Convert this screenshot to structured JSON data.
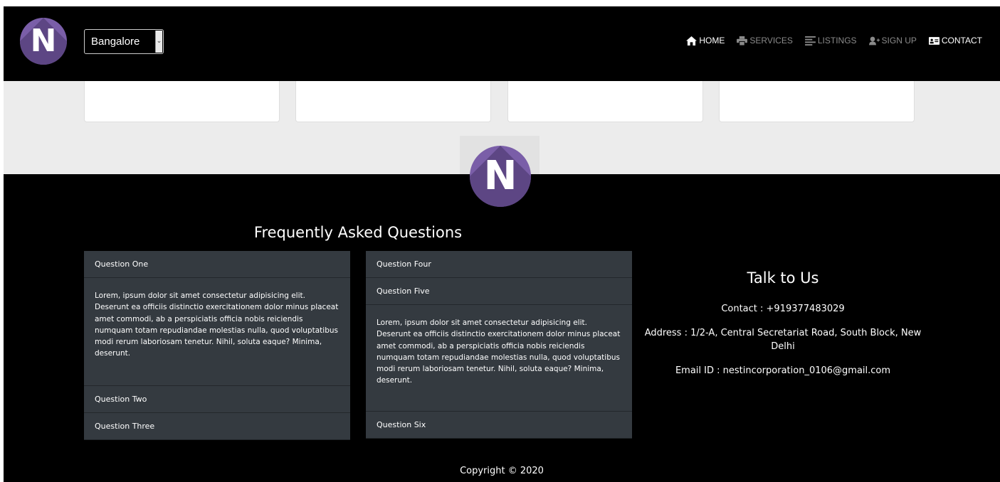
{
  "brand": {
    "logo_letter": "N",
    "accent": "#7a5ea8"
  },
  "navbar": {
    "city": "Bangalore",
    "links": [
      {
        "label": "HOME",
        "icon": "home-icon"
      },
      {
        "label": "SERVICES",
        "icon": "printer-icon"
      },
      {
        "label": "LISTINGS",
        "icon": "list-icon"
      },
      {
        "label": "SIGN UP",
        "icon": "user-plus-icon"
      },
      {
        "label": "CONTACT",
        "icon": "id-card-icon"
      }
    ]
  },
  "faq": {
    "title": "Frequently Asked Questions",
    "left": [
      {
        "q": "Question One",
        "a": "Lorem, ipsum dolor sit amet consectetur adipisicing elit. Deserunt ea officiis distinctio exercitationem dolor minus placeat amet commodi, ab a perspiciatis officia nobis reiciendis numquam totam repudiandae molestias nulla, quod voluptatibus modi rerum laboriosam tenetur. Nihil, soluta eaque? Minima, deserunt."
      },
      {
        "q": "Question Two"
      },
      {
        "q": "Question Three"
      }
    ],
    "right": [
      {
        "q": "Question Four"
      },
      {
        "q": "Question Five",
        "a": "Lorem, ipsum dolor sit amet consectetur adipisicing elit. Deserunt ea officiis distinctio exercitationem dolor minus placeat amet commodi, ab a perspiciatis officia nobis reiciendis numquam totam repudiandae molestias nulla, quod voluptatibus modi rerum laboriosam tenetur. Nihil, soluta eaque? Minima, deserunt."
      },
      {
        "q": "Question Six"
      }
    ]
  },
  "talk": {
    "title": "Talk to Us",
    "contact": "Contact : +919377483029",
    "address": "Address : 1/2-A, Central Secretariat Road, South Block, New Delhi",
    "email": "Email ID : nestincorporation_0106@gmail.com"
  },
  "copyright": "Copyright © 2020"
}
